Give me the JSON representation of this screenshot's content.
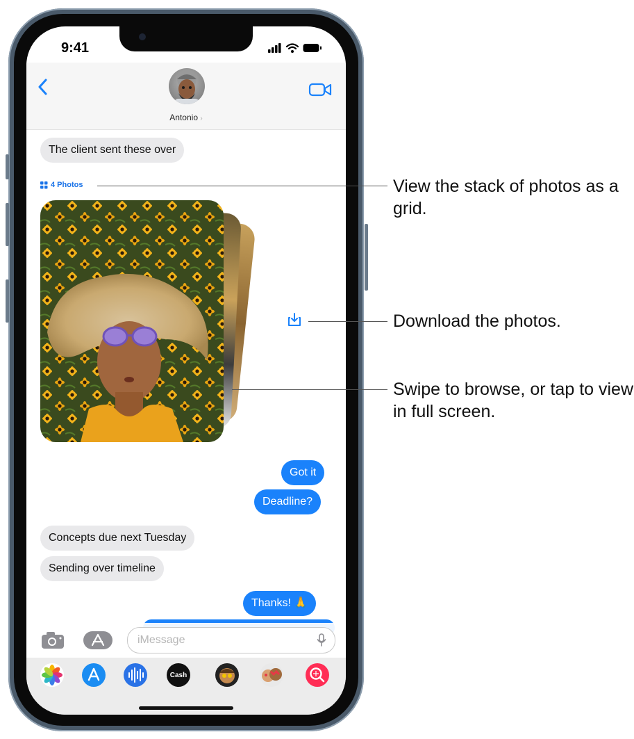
{
  "status_bar": {
    "time": "9:41"
  },
  "conversation": {
    "contact_name": "Antonio",
    "messages": [
      {
        "id": "m1",
        "direction": "incoming",
        "text": "The client sent these over"
      },
      {
        "id": "m2",
        "direction": "outgoing",
        "text": "Got it"
      },
      {
        "id": "m3",
        "direction": "outgoing",
        "text": "Deadline?"
      },
      {
        "id": "m4",
        "direction": "incoming",
        "text": "Concepts due next Tuesday"
      },
      {
        "id": "m5",
        "direction": "incoming",
        "text": "Sending over timeline"
      },
      {
        "id": "m6",
        "direction": "outgoing",
        "text": "Thanks! 🙏"
      }
    ],
    "photo_stack": {
      "label": "4 Photos",
      "count": 4
    }
  },
  "input": {
    "placeholder": "iMessage"
  },
  "app_drawer": {
    "apps": [
      {
        "name": "photos-app-icon"
      },
      {
        "name": "app-store-icon"
      },
      {
        "name": "audio-message-icon"
      },
      {
        "name": "apple-cash-icon",
        "label": "Cash"
      },
      {
        "name": "memoji-icon"
      },
      {
        "name": "memoji-stickers-icon"
      },
      {
        "name": "images-search-icon"
      }
    ]
  },
  "callouts": [
    {
      "id": "c1",
      "text": "View the stack of photos as a grid."
    },
    {
      "id": "c2",
      "text": "Download the photos."
    },
    {
      "id": "c3",
      "text": "Swipe to browse, or tap to view in full screen."
    }
  ],
  "colors": {
    "accent_blue": "#1a82fb",
    "incoming_bubble": "#e9e9eb",
    "frame": "#4a5a6a"
  }
}
